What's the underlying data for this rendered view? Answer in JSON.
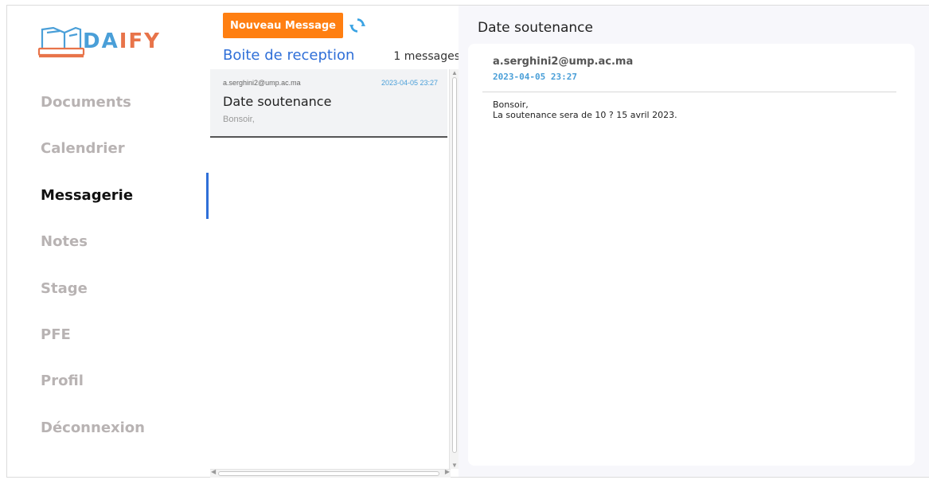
{
  "brand": {
    "name_part1": "DA",
    "name_part2": "IFY",
    "logo_icon": "book-laptop-icon",
    "color1": "#4a9fd8",
    "color2": "#e8744a"
  },
  "sidebar": {
    "items": [
      {
        "label": "Documents",
        "active": false
      },
      {
        "label": "Calendrier",
        "active": false
      },
      {
        "label": "Messagerie",
        "active": true
      },
      {
        "label": "Notes",
        "active": false
      },
      {
        "label": "Stage",
        "active": false
      },
      {
        "label": "PFE",
        "active": false
      },
      {
        "label": "Profil",
        "active": false
      },
      {
        "label": "Déconnexion",
        "active": false
      }
    ],
    "accent_color": "#2f6fd8"
  },
  "inbox": {
    "new_message_label": "Nouveau Message",
    "refresh_icon": "refresh-icon",
    "title": "Boite de reception",
    "count_label": "1 messages",
    "messages": [
      {
        "from": "a.serghini2@ump.ac.ma",
        "date": "2023-04-05 23:27",
        "subject": "Date soutenance",
        "preview": "Bonsoir,"
      }
    ]
  },
  "reader": {
    "title": "Date soutenance",
    "from": "a.serghini2@ump.ac.ma",
    "date": "2023-04-05 23:27",
    "body": "Bonsoir,\nLa soutenance sera de 10 ? 15 avril 2023."
  },
  "colors": {
    "button": "#ff7f11",
    "link": "#2f6fd8",
    "date": "#4a9fd8"
  }
}
